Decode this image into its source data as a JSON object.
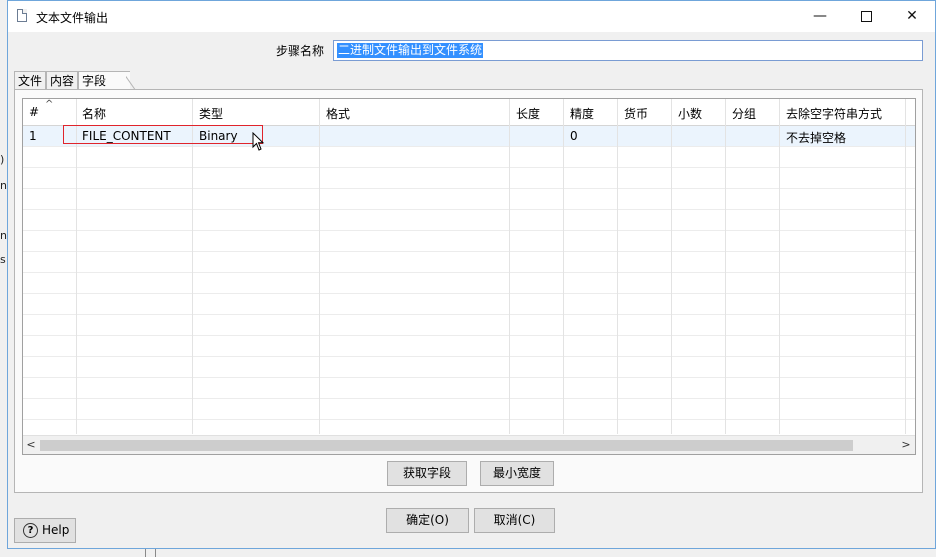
{
  "window": {
    "title": "文本文件输出",
    "minimize_glyph": "—",
    "close_glyph": "✕"
  },
  "step": {
    "label": "步骤名称",
    "value": "二进制文件输出到文件系统"
  },
  "tabs": [
    {
      "label": "文件"
    },
    {
      "label": "内容"
    },
    {
      "label": "字段"
    }
  ],
  "table": {
    "sort_caret": "^",
    "columns": [
      "#",
      "名称",
      "类型",
      "格式",
      "长度",
      "精度",
      "货币",
      "小数",
      "分组",
      "去除空字符串方式"
    ],
    "rows": [
      [
        "1",
        "FILE_CONTENT",
        "Binary",
        "",
        "",
        "0",
        "",
        "",
        "",
        "不去掉空格"
      ]
    ],
    "scroll_left": "<",
    "scroll_right": ">"
  },
  "buttons": {
    "get_fields": "获取字段",
    "min_width": "最小宽度",
    "ok": "确定(O)",
    "cancel": "取消(C)",
    "help": "Help",
    "help_glyph": "?"
  },
  "background_fragments": [
    ")",
    "n",
    "na",
    "s"
  ]
}
